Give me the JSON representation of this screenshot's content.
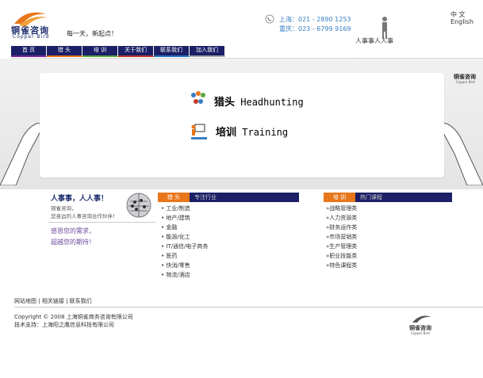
{
  "header": {
    "logo_text": "铜雀咨询",
    "logo_sub": "Copper Bird",
    "slogan": "每一天，新起点！",
    "phone_shanghai": "上海：021 - 2890 1253",
    "phone_chongqing": "重庆：023 - 6799 9169",
    "lang_cn": "中 文",
    "lang_en": "English",
    "hr_slogan": "人事事人人事"
  },
  "nav": [
    {
      "label": "首  页",
      "accent": "#7a2a9a"
    },
    {
      "label": "猎  头",
      "accent": "#e8761a"
    },
    {
      "label": "培  训",
      "accent": "#5aa83a"
    },
    {
      "label": "关于我们",
      "accent": "#c23a2a"
    },
    {
      "label": "联系我们",
      "accent": "#2a7ac2"
    },
    {
      "label": "加入我们",
      "accent": "#a7a7a7"
    }
  ],
  "banner": {
    "brand": "铜雀咨询",
    "brand_sub": "Copper Bird",
    "headhunting_cn": "猎头",
    "headhunting_en": "Headhunting",
    "training_cn": "培训",
    "training_en": "Training"
  },
  "intro": {
    "title": "人事事，人人事！",
    "line1": "铜雀咨询，",
    "line2": "您身边的人事咨询合作伙伴！",
    "thanks1": "感恩您的需求，",
    "thanks2": "超越您的期待！"
  },
  "headhunting_section": {
    "tag": "猎  头",
    "sub": "专注行业",
    "items": [
      "工业/制造",
      "地产/建筑",
      "金融",
      "能源/化工",
      "IT/通信/电子商务",
      "医药",
      "快消/零售",
      "物流/酒店"
    ]
  },
  "training_section": {
    "tag": "培  训",
    "sub": "热门课程",
    "items": [
      "»战略管理类",
      "»人力资源类",
      "»财务运作类",
      "»市场营销类",
      "»生产管理类",
      "»职业技能类",
      "»特色课程类"
    ]
  },
  "footer": {
    "link_sitemap": "网站地图",
    "link_related": "相关链接",
    "link_contact": "联系我们",
    "copyright": "Copyright © 2008 上海铜雀商务咨询有限公司",
    "support": "技术支持：上海阳之鹰信息科技有限公司",
    "logo_text": "铜雀咨询",
    "logo_sub": "Copper Bird"
  }
}
